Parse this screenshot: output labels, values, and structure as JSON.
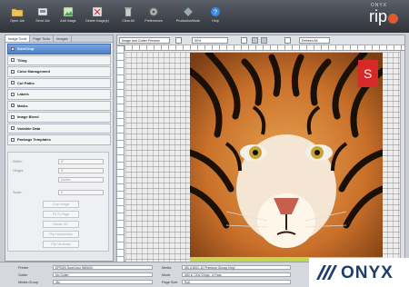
{
  "toolbar": {
    "buttons": [
      {
        "label": "Open Job",
        "icon": "folder-icon"
      },
      {
        "label": "Send Job",
        "icon": "send-icon"
      },
      {
        "label": "Add Image",
        "icon": "add-image-icon"
      },
      {
        "label": "Delete Image(s)",
        "icon": "delete-image-icon"
      },
      {
        "label": "Clear All",
        "icon": "trash-icon"
      },
      {
        "label": "Preferences",
        "icon": "gear-icon"
      },
      {
        "label": "ProductionMode",
        "icon": "diamond-icon"
      },
      {
        "label": "Help",
        "icon": "help-icon"
      }
    ],
    "brand_small": "ONYX",
    "brand_large": "rip"
  },
  "left_panel": {
    "tabs": [
      "Image Tools",
      "Page Tools",
      "Images"
    ],
    "sections": [
      "Size/Crop",
      "Tiling",
      "Color Management",
      "Cut Paths",
      "Labels",
      "Marks",
      "Image Bleed",
      "Variable Data",
      "Package Templates"
    ],
    "fields": [
      {
        "label": "Width:",
        "value": "8\""
      },
      {
        "label": "Height:",
        "value": "5\""
      },
      {
        "label": "",
        "value": "Inches"
      },
      {
        "label": "Scale:",
        "value": "0"
      }
    ],
    "buttons": [
      "Crop Image",
      "Fit To Page",
      "Rotate 90°",
      "Flip Horizontally",
      "Flip Vertically"
    ]
  },
  "viewer": {
    "view_select": "Image and Gutter Preview",
    "zoom": "50%",
    "refresh": "Refresh All"
  },
  "bottom": {
    "rows": [
      {
        "label": "Printer",
        "value": "EPSON SureColor S80600"
      },
      {
        "label": "Gutter",
        "value": "No Gutter"
      },
      {
        "label": "Media Group",
        "value": "3M"
      }
    ],
    "rows_right": [
      {
        "label": "Media",
        "value": "3M IJ180C-10 Premium Glossy Vinyl"
      },
      {
        "label": "Mode",
        "value": "360 & 720x720dpi - 6 Pass"
      },
      {
        "label": "Page Size",
        "value": "Roll"
      }
    ]
  },
  "logo_text": "ONYX",
  "colors": {
    "toolbar": "#3b3f46",
    "active_section": "#4b7fc9",
    "brand_dot": "#e0582c",
    "logo": "#1f3c6e"
  }
}
